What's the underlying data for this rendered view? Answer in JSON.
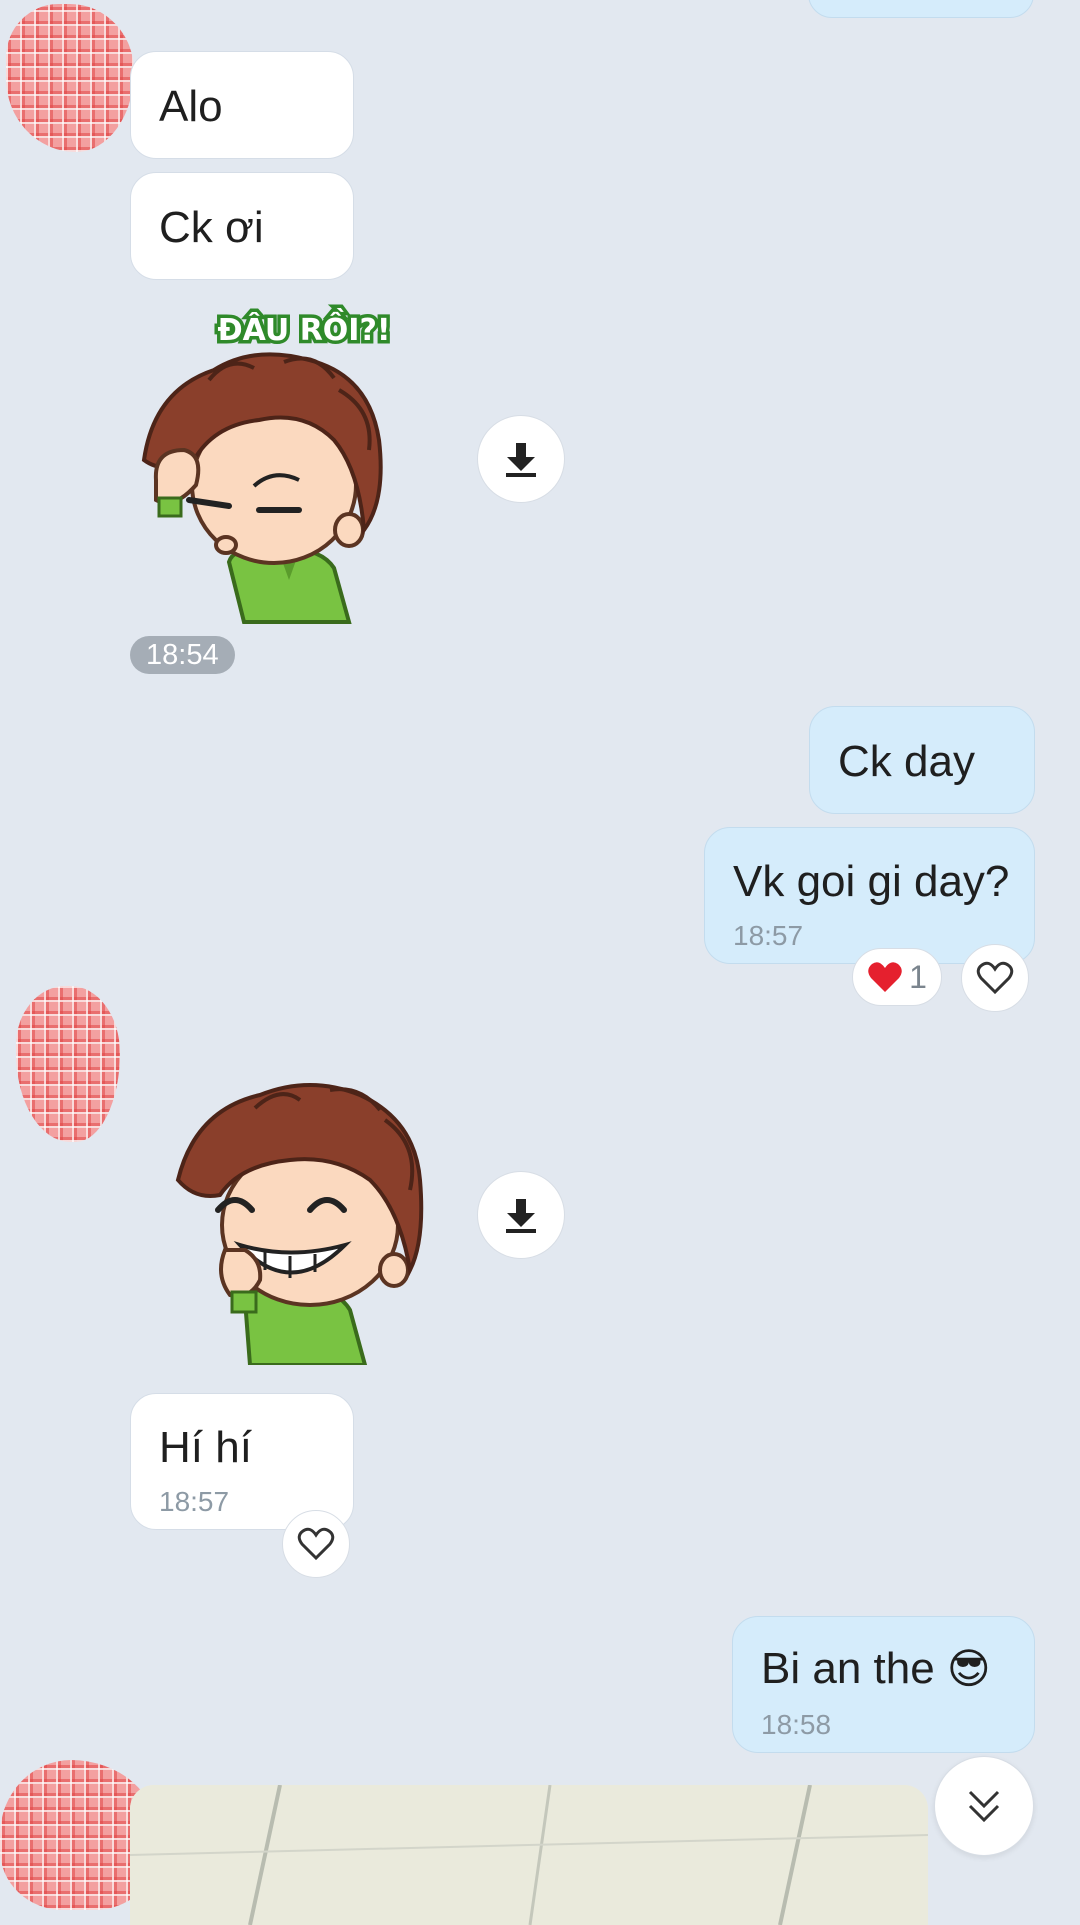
{
  "messages": {
    "m1": {
      "text": "Alo"
    },
    "m2": {
      "text": "Ck ơi"
    },
    "sticker1": {
      "caption": "ĐÂU RỒI?!",
      "time": "18:54"
    },
    "m3": {
      "text": "Ck day"
    },
    "m4": {
      "text": "Vk goi gi day?",
      "time": "18:57",
      "reaction_count": "1"
    },
    "m5": {
      "text": "Hí hí",
      "time": "18:57"
    },
    "m6": {
      "text": "Bi an the",
      "emoji": "😎",
      "time": "18:58"
    }
  },
  "icons": {
    "download": "download-icon",
    "heart": "heart-outline-icon",
    "heart_filled": "heart-filled-icon",
    "scroll_down": "chevron-double-down-icon"
  },
  "colors": {
    "background": "#e2e8f0",
    "incoming_bubble": "#ffffff",
    "outgoing_bubble": "#d5ecfb",
    "reaction_red": "#e5202e"
  }
}
